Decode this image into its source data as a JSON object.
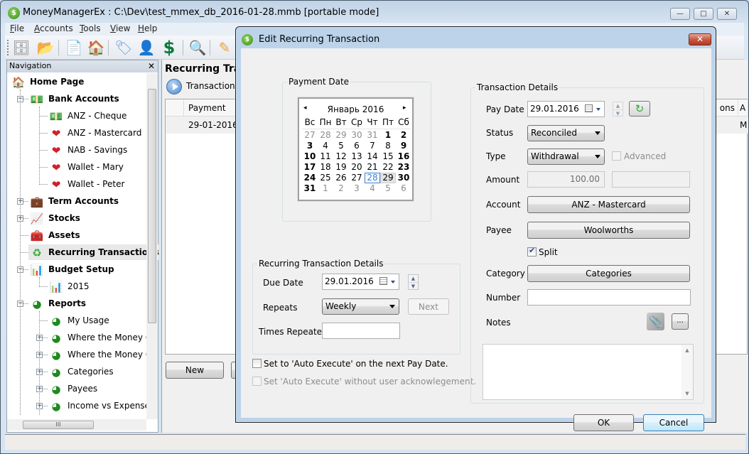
{
  "app": {
    "title": "MoneyManagerEx : C:\\Dev\\test_mmex_db_2016-01-28.mmb [portable mode]",
    "window_buttons": {
      "minimize": "—",
      "maximize": "□",
      "close": "✕"
    }
  },
  "menu": [
    {
      "label": "File",
      "accel": "F",
      "rest": "ile"
    },
    {
      "label": "Accounts",
      "accel": "A",
      "rest": "ccounts"
    },
    {
      "label": "Tools",
      "accel": "T",
      "rest": "ools"
    },
    {
      "label": "View",
      "accel": "V",
      "rest": "iew"
    },
    {
      "label": "Help",
      "accel": "H",
      "rest": "elp"
    }
  ],
  "toolbar": [
    {
      "name": "database-icon",
      "glyph": "🗄"
    },
    {
      "name": "open-folder-icon",
      "glyph": "📂"
    },
    {
      "name": "new-file-icon",
      "glyph": "📄"
    },
    {
      "name": "home-icon",
      "glyph": "🏠"
    },
    {
      "name": "tag-icon",
      "glyph": "🏷"
    },
    {
      "name": "user-icon",
      "glyph": "👤"
    },
    {
      "name": "dollar-icon",
      "glyph": "$"
    },
    {
      "name": "find-icon",
      "glyph": "🔍"
    },
    {
      "name": "edit-search-icon",
      "glyph": "✎"
    }
  ],
  "navigation": {
    "title": "Navigation",
    "close": "✕",
    "items": [
      {
        "label": "Home Page",
        "icon": "home-icon",
        "glyph": "🏠",
        "bold": true
      },
      {
        "label": "Bank Accounts",
        "icon": "money-icon",
        "glyph": "💵",
        "bold": true,
        "expander": "−"
      },
      {
        "label": "ANZ - Cheque",
        "icon": "money-icon",
        "glyph": "💵"
      },
      {
        "label": "ANZ - Mastercard",
        "icon": "favorite-money-icon",
        "glyph": "❤"
      },
      {
        "label": "NAB - Savings",
        "icon": "favorite-money-icon",
        "glyph": "❤"
      },
      {
        "label": "Wallet - Mary",
        "icon": "favorite-money-icon",
        "glyph": "❤"
      },
      {
        "label": "Wallet - Peter",
        "icon": "favorite-money-icon",
        "glyph": "❤"
      },
      {
        "label": "Term Accounts",
        "icon": "briefcase-icon",
        "glyph": "💼",
        "bold": true,
        "expander": "+"
      },
      {
        "label": "Stocks",
        "icon": "stocks-chart-icon",
        "glyph": "📈",
        "bold": true,
        "expander": "+"
      },
      {
        "label": "Assets",
        "icon": "treasure-chest-icon",
        "glyph": "🧰",
        "bold": true
      },
      {
        "label": "Recurring Transactions",
        "icon": "recurring-icon",
        "glyph": "♻",
        "bold": true,
        "selected": true
      },
      {
        "label": "Budget Setup",
        "icon": "bar-chart-icon",
        "glyph": "📊",
        "bold": true,
        "expander": "−"
      },
      {
        "label": "2015",
        "icon": "bar-chart-icon",
        "glyph": "📊"
      },
      {
        "label": "Reports",
        "icon": "pie-chart-icon",
        "glyph": "◕",
        "bold": true,
        "expander": "−"
      },
      {
        "label": "My Usage",
        "icon": "pie-chart-icon",
        "glyph": "◕"
      },
      {
        "label": "Where the Money G",
        "icon": "pie-chart-icon",
        "glyph": "◕",
        "expander": "+"
      },
      {
        "label": "Where the Money C",
        "icon": "pie-chart-icon",
        "glyph": "◕",
        "expander": "+"
      },
      {
        "label": "Categories",
        "icon": "pie-chart-icon",
        "glyph": "◕",
        "expander": "+"
      },
      {
        "label": "Payees",
        "icon": "pie-chart-icon",
        "glyph": "◕",
        "expander": "+"
      },
      {
        "label": "Income vs Expenses",
        "icon": "pie-chart-icon",
        "glyph": "◕",
        "expander": "+"
      }
    ],
    "hscroll_grip": "III"
  },
  "main": {
    "title": "Recurring Tran",
    "filter_label": "Transaction F",
    "columns": [
      "Payment Dat",
      "ons",
      "A"
    ],
    "rows": [
      [
        "29-01-2016",
        "",
        "M"
      ]
    ],
    "buttons": {
      "new": "New"
    }
  },
  "dialog": {
    "title": "Edit Recurring Transaction",
    "close": "✕",
    "payment_date": {
      "group_label": "Payment Date",
      "month_label": "Январь 2016",
      "prev": "◂",
      "next": "▸",
      "weekdays": [
        "Вс",
        "Пн",
        "Вт",
        "Ср",
        "Чт",
        "Пт",
        "Сб"
      ],
      "weeks": [
        [
          {
            "d": "27",
            "o": 1
          },
          {
            "d": "28",
            "o": 1
          },
          {
            "d": "29",
            "o": 1
          },
          {
            "d": "30",
            "o": 1
          },
          {
            "d": "31",
            "o": 1
          },
          {
            "d": "1",
            "b": 1
          },
          {
            "d": "2",
            "b": 1
          }
        ],
        [
          {
            "d": "3",
            "b": 1
          },
          {
            "d": "4"
          },
          {
            "d": "5"
          },
          {
            "d": "6"
          },
          {
            "d": "7"
          },
          {
            "d": "8"
          },
          {
            "d": "9",
            "b": 1
          }
        ],
        [
          {
            "d": "10",
            "b": 1
          },
          {
            "d": "11"
          },
          {
            "d": "12"
          },
          {
            "d": "13"
          },
          {
            "d": "14"
          },
          {
            "d": "15"
          },
          {
            "d": "16",
            "b": 1
          }
        ],
        [
          {
            "d": "17",
            "b": 1
          },
          {
            "d": "18"
          },
          {
            "d": "19"
          },
          {
            "d": "20"
          },
          {
            "d": "21"
          },
          {
            "d": "22"
          },
          {
            "d": "23",
            "b": 1
          }
        ],
        [
          {
            "d": "24",
            "b": 1
          },
          {
            "d": "25"
          },
          {
            "d": "26"
          },
          {
            "d": "27"
          },
          {
            "d": "28",
            "t": 1
          },
          {
            "d": "29",
            "s": 1
          },
          {
            "d": "30",
            "b": 1
          }
        ],
        [
          {
            "d": "31",
            "b": 1
          },
          {
            "d": "1",
            "o": 1
          },
          {
            "d": "2",
            "o": 1
          },
          {
            "d": "3",
            "o": 1
          },
          {
            "d": "4",
            "o": 1
          },
          {
            "d": "5",
            "o": 1
          },
          {
            "d": "6",
            "o": 1
          }
        ]
      ]
    },
    "recurring": {
      "group_label": "Recurring Transaction Details",
      "due_date_label": "Due Date",
      "due_date_value": "29.01.2016",
      "repeats_label": "Repeats",
      "repeats_value": "Weekly",
      "next_button": "Next",
      "times_repeated_label": "Times Repeated",
      "times_repeated_value": ""
    },
    "auto_execute": {
      "label": "Set to 'Auto Execute' on the next Pay Date.",
      "checked": false
    },
    "auto_execute_silent": {
      "label": "Set 'Auto Execute' without user acknowlegement.",
      "checked": false,
      "disabled": true
    },
    "transaction": {
      "group_label": "Transaction Details",
      "pay_date_label": "Pay Date",
      "pay_date_value": "29.01.2016",
      "status_label": "Status",
      "status_value": "Reconciled",
      "type_label": "Type",
      "type_value": "Withdrawal",
      "advanced_label": "Advanced",
      "amount_label": "Amount",
      "amount_value": "100.00",
      "amount2_value": "",
      "account_label": "Account",
      "account_value": "ANZ - Mastercard",
      "payee_label": "Payee",
      "payee_value": "Woolworths",
      "split_label": "Split",
      "split_checked": true,
      "category_label": "Category",
      "category_value": "Categories",
      "number_label": "Number",
      "number_value": "",
      "notes_label": "Notes",
      "notes_more": "...",
      "notes_value": ""
    },
    "buttons": {
      "ok": "OK",
      "cancel": "Cancel"
    }
  }
}
